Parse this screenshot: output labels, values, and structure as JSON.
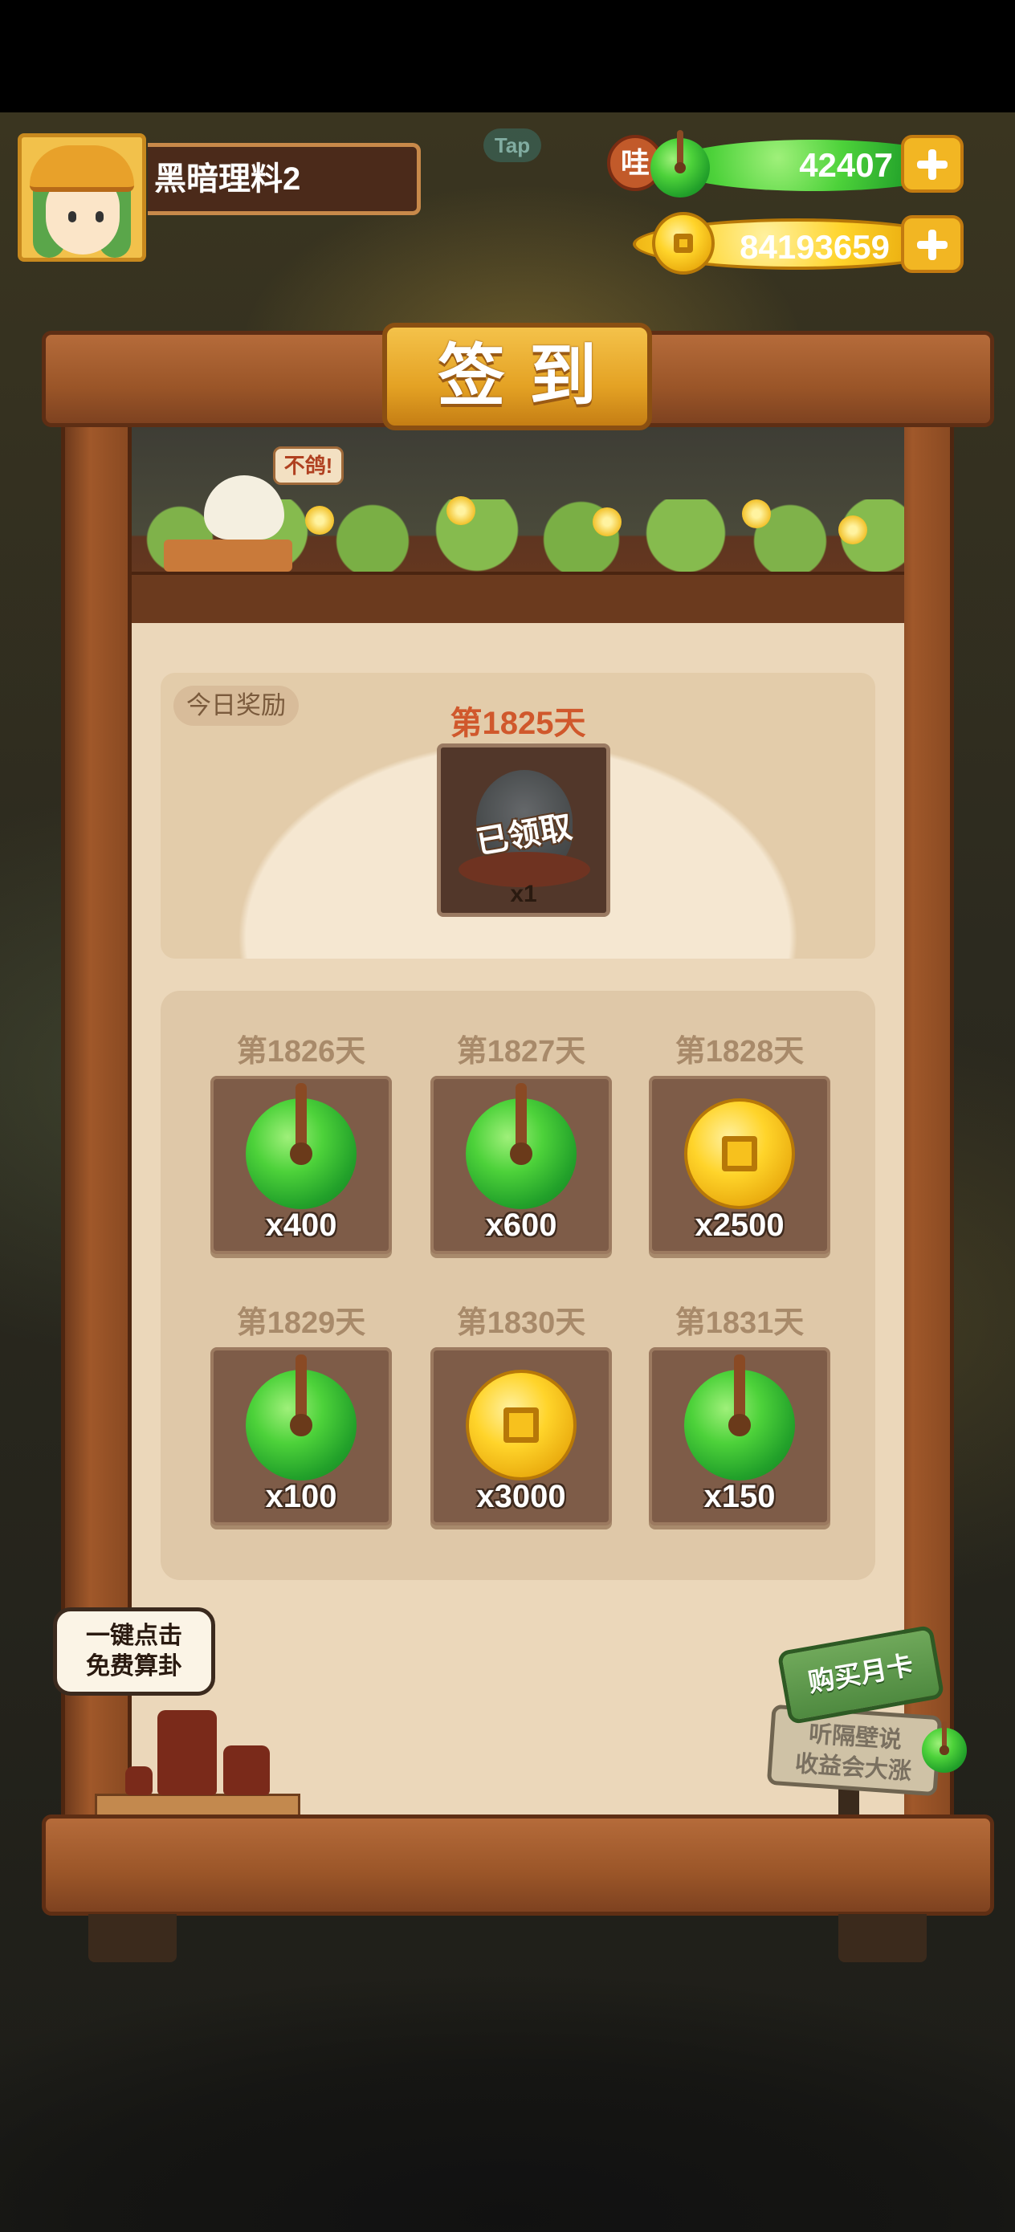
{
  "player": {
    "name": "黑暗理料2"
  },
  "resources": {
    "jade_badge": "哇",
    "jade": "42407",
    "coins": "84193659"
  },
  "tap_hint": "Tap",
  "panel": {
    "title": "签到"
  },
  "decor": {
    "bubble": "不鸽!"
  },
  "today": {
    "tag": "今日奖励",
    "day_label": "第1825天",
    "status": "已领取",
    "quantity": "x1"
  },
  "upcoming": [
    {
      "day_label": "第1826天",
      "reward": "jade-icon",
      "quantity": "x400"
    },
    {
      "day_label": "第1827天",
      "reward": "jade-icon",
      "quantity": "x600"
    },
    {
      "day_label": "第1828天",
      "reward": "coin-icon",
      "quantity": "x2500"
    },
    {
      "day_label": "第1829天",
      "reward": "jade-icon",
      "quantity": "x100"
    },
    {
      "day_label": "第1830天",
      "reward": "coin-icon",
      "quantity": "x3000"
    },
    {
      "day_label": "第1831天",
      "reward": "jade-icon",
      "quantity": "x150"
    }
  ],
  "fortune": {
    "line1": "一键点击",
    "line2": "免费算卦"
  },
  "monthly_card": {
    "button": "购买月卡",
    "line1": "听隔壁说",
    "line2": "收益会大涨"
  },
  "colors": {
    "accent_gold": "#f2b623",
    "day_highlight": "#d0582c",
    "panel_bg": "#ebd7ba"
  }
}
